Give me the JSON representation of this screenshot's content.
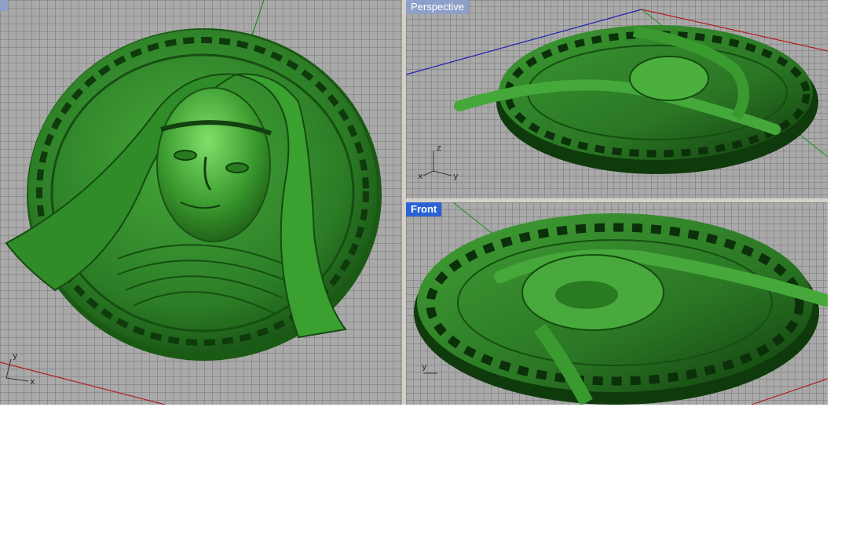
{
  "viewports": {
    "top": {
      "label": ""
    },
    "perspective": {
      "label": "Perspective"
    },
    "front": {
      "label": "Front"
    }
  },
  "axis_labels": {
    "top": {
      "x": "x",
      "y": "y"
    },
    "perspective": {
      "x": "x",
      "y": "y",
      "z": "z"
    },
    "front": {
      "y": "y"
    }
  },
  "colors": {
    "model": "#2c7d26",
    "model_dark": "#13450f",
    "model_light": "#6fd35f",
    "grid_bg": "#a9a9a9",
    "active_label": "#2a62d4",
    "inactive_label": "#8ea0c8",
    "x_axis": "#b02020",
    "y_axis": "#1f8a1f",
    "z_axis": "#2020b0"
  }
}
